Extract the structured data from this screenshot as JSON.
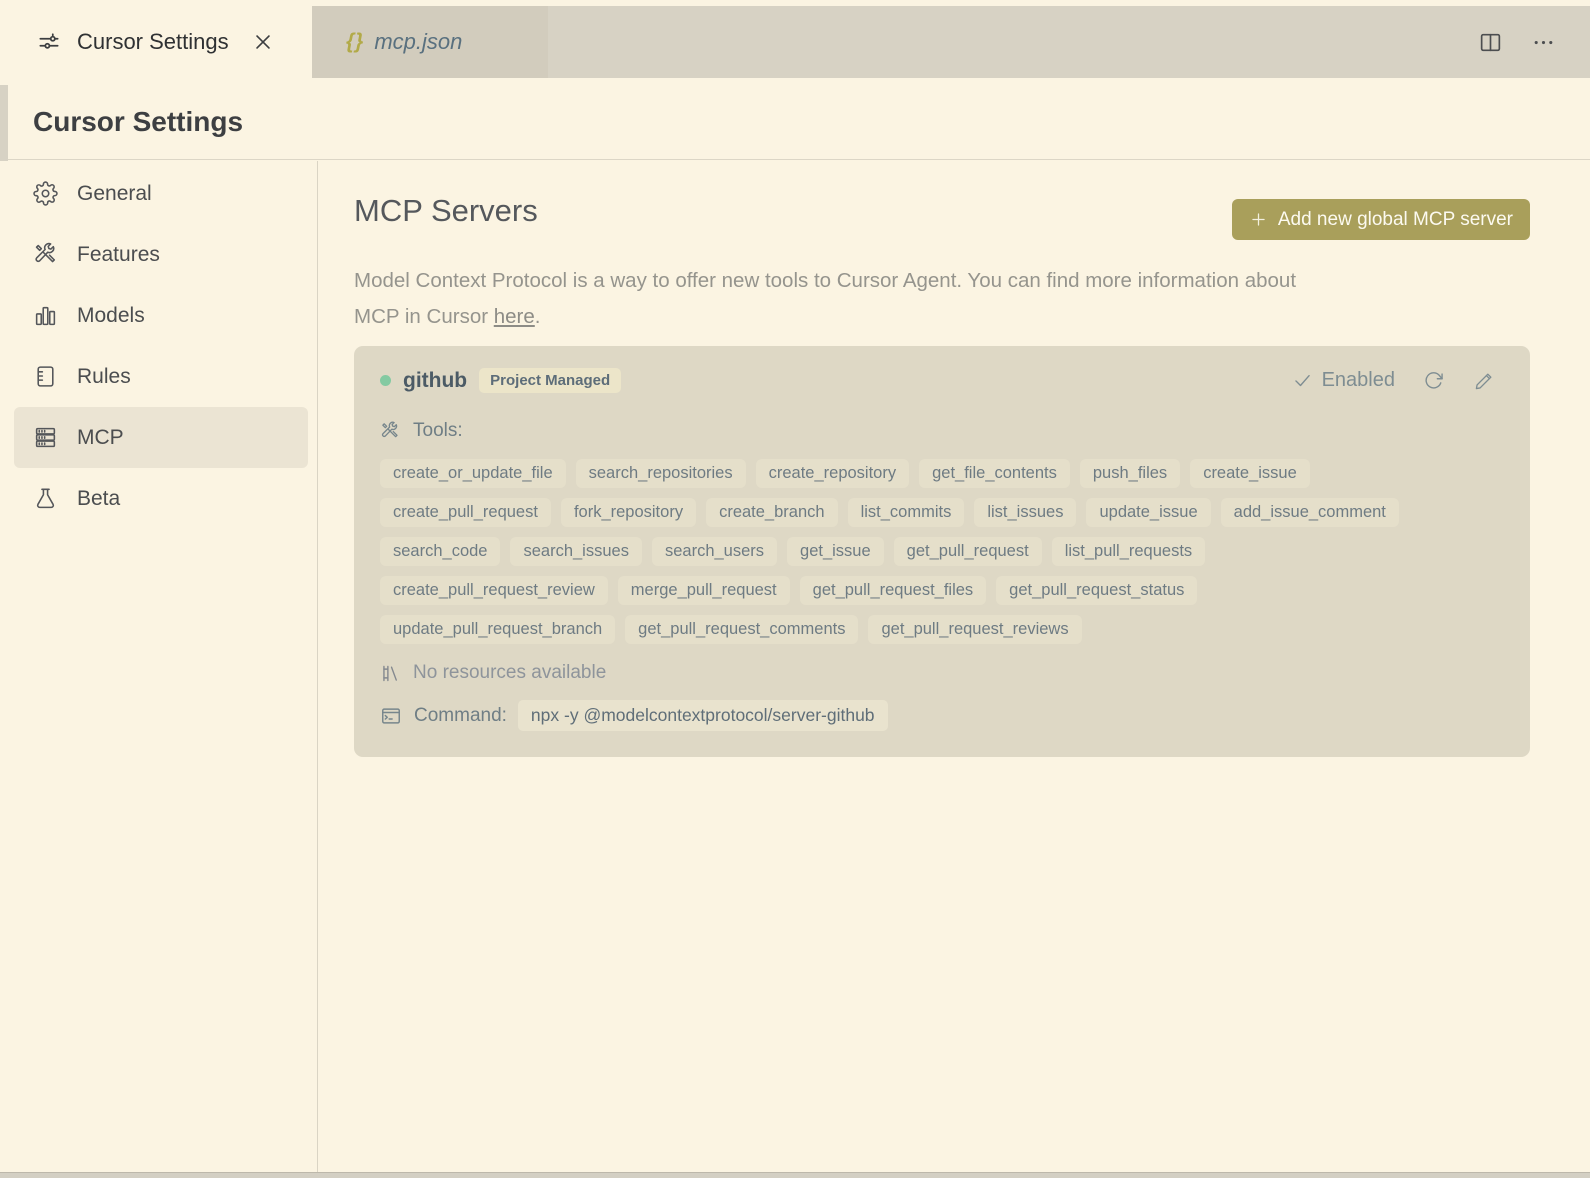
{
  "colors": {
    "accent_button": "#a99f5b",
    "status_dot_green": "#84caa2",
    "card_background": "#ded8c5",
    "page_background": "#fbf4e2"
  },
  "tab_bar": {
    "tabs": [
      {
        "label": "Cursor Settings",
        "active": true
      },
      {
        "label": "mcp.json",
        "active": false,
        "braces_glyph": "{}"
      }
    ]
  },
  "page": {
    "title": "Cursor Settings"
  },
  "sidebar": {
    "items": [
      {
        "label": "General"
      },
      {
        "label": "Features"
      },
      {
        "label": "Models"
      },
      {
        "label": "Rules"
      },
      {
        "label": "MCP"
      },
      {
        "label": "Beta"
      }
    ]
  },
  "main": {
    "title": "MCP Servers",
    "add_button_label": "Add new global MCP server",
    "description": {
      "line1": "Model Context Protocol is a way to offer new tools to Cursor Agent. You can find more information about",
      "line2_prefix": "MCP in Cursor ",
      "link_text": "here",
      "suffix": "."
    },
    "server": {
      "name": "github",
      "badge": "Project Managed",
      "status_label": "Enabled",
      "tools_label": "Tools:",
      "tool_rows": [
        [
          "create_or_update_file",
          "search_repositories",
          "create_repository",
          "get_file_contents",
          "push_files",
          "create_issue"
        ],
        [
          "create_pull_request",
          "fork_repository",
          "create_branch",
          "list_commits",
          "list_issues",
          "update_issue",
          "add_issue_comment"
        ],
        [
          "search_code",
          "search_issues",
          "search_users",
          "get_issue",
          "get_pull_request",
          "list_pull_requests"
        ],
        [
          "create_pull_request_review",
          "merge_pull_request",
          "get_pull_request_files",
          "get_pull_request_status"
        ],
        [
          "update_pull_request_branch",
          "get_pull_request_comments",
          "get_pull_request_reviews"
        ]
      ],
      "resources_label": "No resources available",
      "command_label": "Command:",
      "command": "npx -y @modelcontextprotocol/server-github"
    }
  }
}
